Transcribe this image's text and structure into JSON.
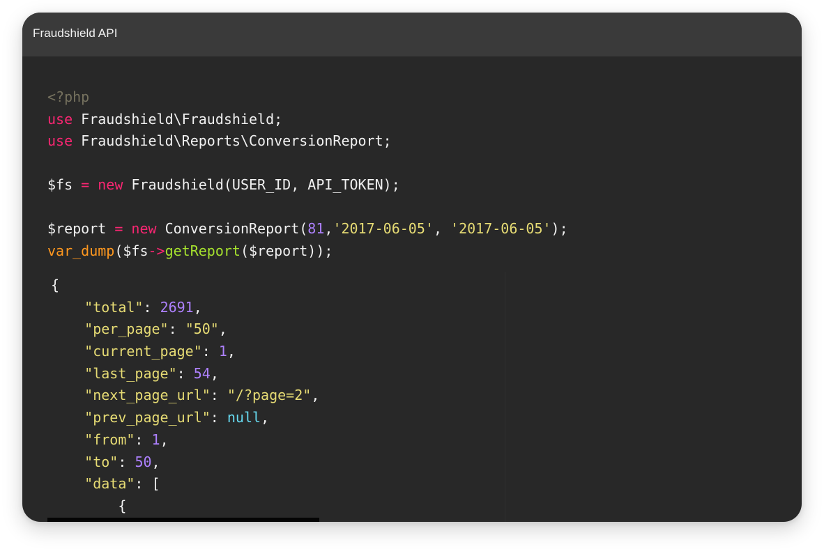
{
  "window": {
    "title": "Fraudshield API"
  },
  "code": {
    "php_open": "<?php",
    "line_use_1": {
      "kw": "use",
      "rest": " Fraudshield\\Fraudshield;"
    },
    "line_use_2": {
      "kw": "use",
      "rest": " Fraudshield\\Reports\\ConversionReport;"
    },
    "line_fs": {
      "var": "$fs ",
      "eq": "=",
      "sp": " ",
      "kw": "new",
      "rest": " Fraudshield(USER_ID, API_TOKEN);"
    },
    "line_report": {
      "var": "$report ",
      "eq": "=",
      "sp": " ",
      "kw": "new",
      "cls": " ConversionReport(",
      "num": "81",
      "comma1": ",",
      "str1": "'2017-06-05'",
      "comma2": ", ",
      "str2": "'2017-06-05'",
      "end": ");"
    },
    "line_dump": {
      "fn": "var_dump",
      "open": "($fs",
      "arrow": "->",
      "method": "getReport",
      "end": "($report));"
    }
  },
  "json": {
    "open_brace": "{",
    "rows": [
      {
        "key": "\"total\"",
        "sep": ": ",
        "value": "2691",
        "type": "num",
        "tail": ","
      },
      {
        "key": "\"per_page\"",
        "sep": ": ",
        "value": "\"50\"",
        "type": "str",
        "tail": ","
      },
      {
        "key": "\"current_page\"",
        "sep": ": ",
        "value": "1",
        "type": "num",
        "tail": ","
      },
      {
        "key": "\"last_page\"",
        "sep": ": ",
        "value": "54",
        "type": "num",
        "tail": ","
      },
      {
        "key": "\"next_page_url\"",
        "sep": ": ",
        "value": "\"/?page=2\"",
        "type": "str",
        "tail": ","
      },
      {
        "key": "\"prev_page_url\"",
        "sep": ": ",
        "value": "null",
        "type": "null",
        "tail": ","
      },
      {
        "key": "\"from\"",
        "sep": ": ",
        "value": "1",
        "type": "num",
        "tail": ","
      },
      {
        "key": "\"to\"",
        "sep": ": ",
        "value": "50",
        "type": "num",
        "tail": ","
      },
      {
        "key": "\"data\"",
        "sep": ": ",
        "value": "[",
        "type": "plain",
        "tail": ""
      }
    ],
    "inner_brace": "{"
  },
  "colors": {
    "keyword": "#f92672",
    "string": "#e6db74",
    "number": "#ae81ff",
    "function": "#a6e22e",
    "builtin": "#fd971f",
    "null": "#66d9ef",
    "comment": "#75715e"
  }
}
